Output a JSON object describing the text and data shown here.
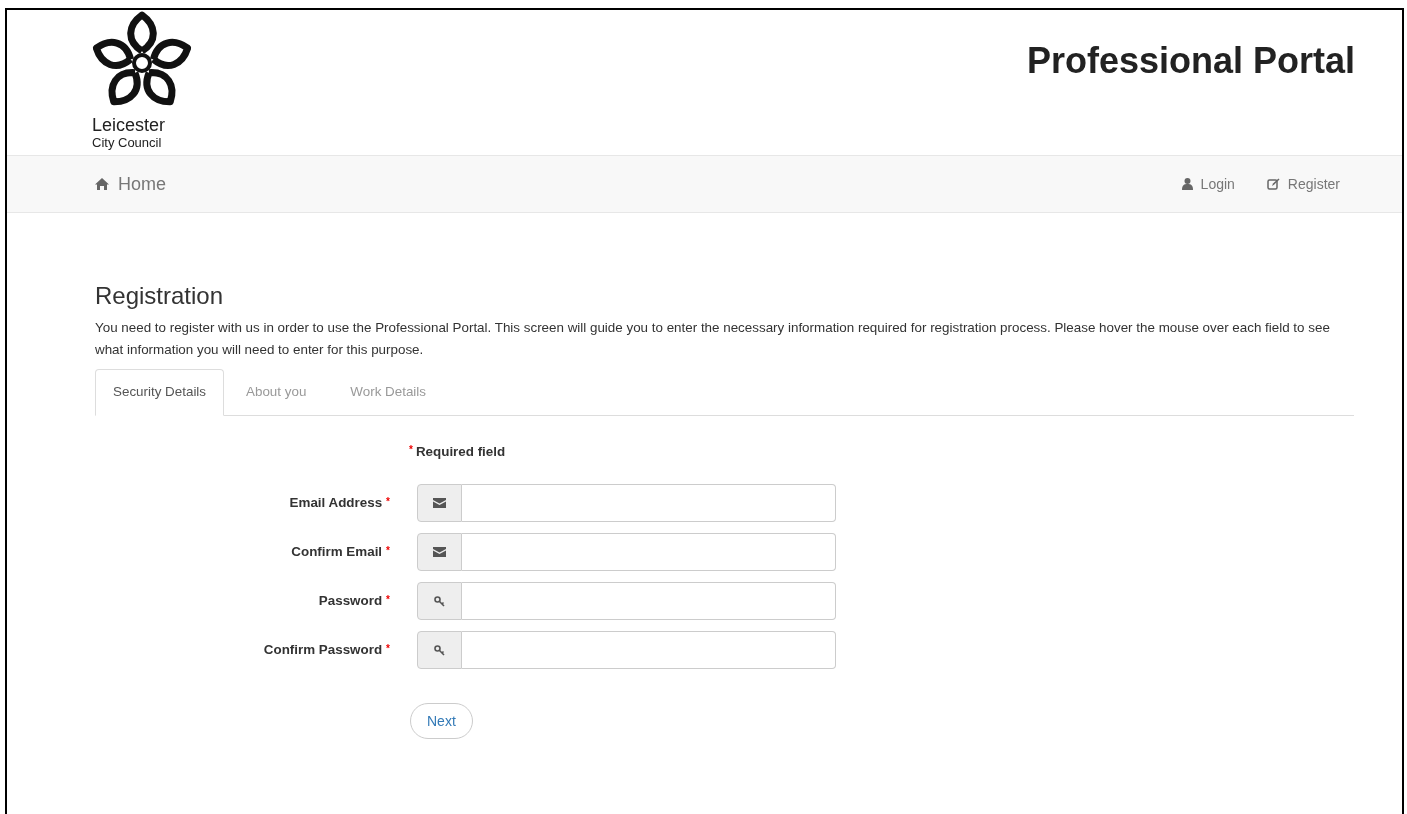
{
  "header": {
    "logo_line_1": "Leicester",
    "logo_line_2": "City Council",
    "title": "Professional Portal"
  },
  "nav": {
    "home": "Home",
    "links": [
      {
        "kind": "login",
        "label": "Login"
      },
      {
        "kind": "register",
        "label": "Register"
      }
    ]
  },
  "page": {
    "heading": "Registration",
    "intro": "You need to register with us in order to use the Professional Portal. This screen will guide you to enter the necessary information required for registration process. Please hover the mouse over each field to see what information you will need to enter for this purpose."
  },
  "tabs": [
    {
      "label": "Security Details",
      "selected": true
    },
    {
      "label": "About you",
      "selected": false
    },
    {
      "label": "Work Details",
      "selected": false
    }
  ],
  "required_legend": {
    "mark": "*",
    "text": "Required field"
  },
  "fields": [
    {
      "kind": "email",
      "label": "Email Address",
      "required_mark": "*"
    },
    {
      "kind": "email",
      "label": "Confirm Email",
      "required_mark": "*"
    },
    {
      "kind": "password",
      "label": "Password",
      "required_mark": "*"
    },
    {
      "kind": "password",
      "label": "Confirm Password",
      "required_mark": "*"
    }
  ],
  "next_button": "Next"
}
